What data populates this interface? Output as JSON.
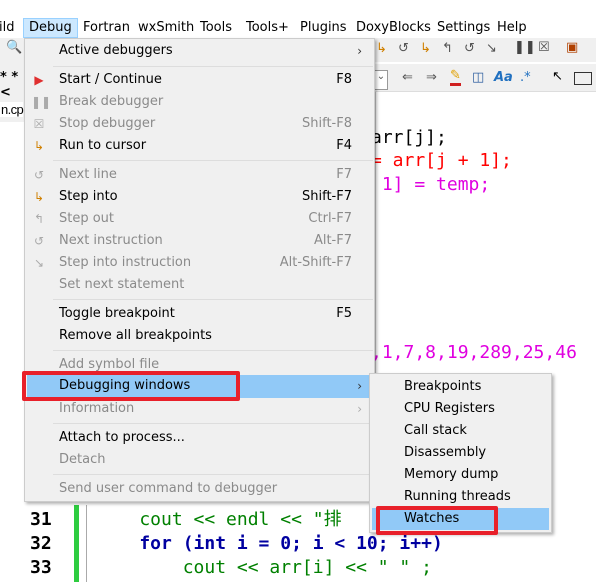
{
  "menubar": {
    "items": [
      "ild",
      "Debug",
      "Fortran",
      "wxSmith",
      "Tools",
      "Tools+",
      "Plugins",
      "DoxyBlocks",
      "Settings",
      "Help"
    ],
    "active": "Debug"
  },
  "left_fragments": {
    "toolbar_text": "* *<",
    "tab": "n.cp"
  },
  "debug_menu": {
    "active_debuggers": "Active debuggers",
    "start": {
      "label": "Start / Continue",
      "shortcut": "F8"
    },
    "break": {
      "label": "Break debugger"
    },
    "stop": {
      "label": "Stop debugger",
      "shortcut": "Shift-F8"
    },
    "run_to_cursor": {
      "label": "Run to cursor",
      "shortcut": "F4"
    },
    "next_line": {
      "label": "Next line",
      "shortcut": "F7"
    },
    "step_into": {
      "label": "Step into",
      "shortcut": "Shift-F7"
    },
    "step_out": {
      "label": "Step out",
      "shortcut": "Ctrl-F7"
    },
    "next_instruction": {
      "label": "Next instruction",
      "shortcut": "Alt-F7"
    },
    "step_into_instruction": {
      "label": "Step into instruction",
      "shortcut": "Alt-Shift-F7"
    },
    "set_next_statement": {
      "label": "Set next statement"
    },
    "toggle_breakpoint": {
      "label": "Toggle breakpoint",
      "shortcut": "F5"
    },
    "remove_all_breakpoints": {
      "label": "Remove all breakpoints"
    },
    "add_symbol_file": {
      "label": "Add symbol file"
    },
    "debugging_windows": {
      "label": "Debugging windows"
    },
    "information": {
      "label": "Information"
    },
    "attach": {
      "label": "Attach to process..."
    },
    "detach": {
      "label": "Detach"
    },
    "send_command": {
      "label": "Send user command to debugger"
    }
  },
  "submenu": {
    "items": [
      "Breakpoints",
      "CPU Registers",
      "Call stack",
      "Disassembly",
      "Memory dump",
      "Running threads",
      "Watches"
    ],
    "highlighted": "Watches"
  },
  "code": {
    "l1": "arr[j];",
    "l2": "= arr[j + 1];",
    "l3": " 1] = temp;",
    "l4": ",1,7,8,19,289,25,46",
    "lines": [
      {
        "num": "31",
        "text": "    cout << endl << \"排"
      },
      {
        "num": "32",
        "text": "    for (int i = 0; i < 10; i++)"
      },
      {
        "num": "33",
        "text": "        cout << arr[i] << \" \" ;"
      }
    ]
  },
  "colors": {
    "highlight": "#91c9f7",
    "annotation": "#e8202a",
    "keyword": "#0000a0",
    "identifier_green": "#008000",
    "number": "#e000e0",
    "operator": "#ff0000"
  }
}
